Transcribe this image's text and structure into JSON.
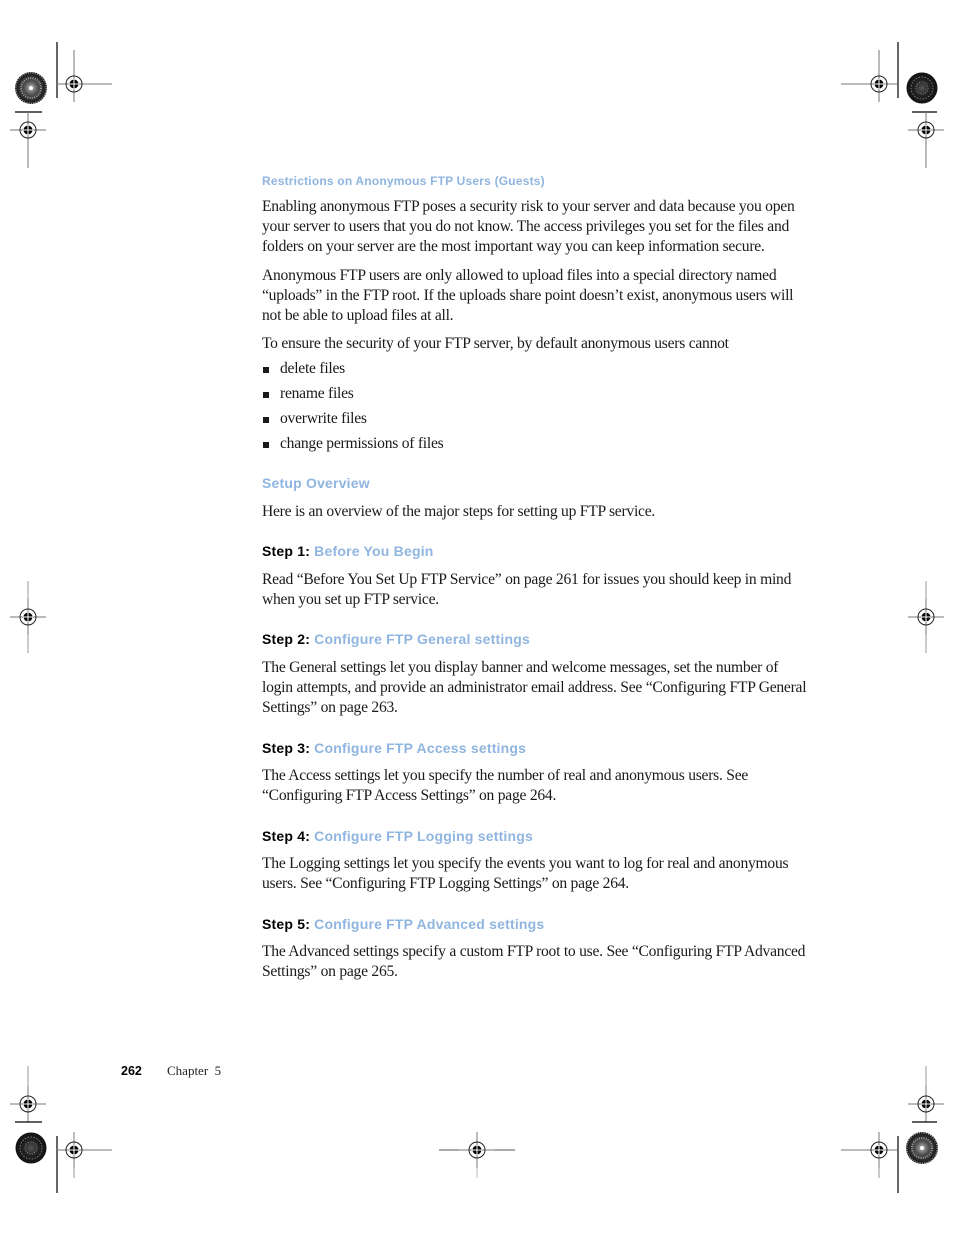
{
  "section_heading": "Restrictions on Anonymous FTP Users (Guests)",
  "paragraphs": {
    "p1": "Enabling anonymous FTP poses a security risk to your server and data because you open your server to users that you do not know. The access privileges you set for the files and folders on your server are the most important way you can keep information secure.",
    "p2": "Anonymous FTP users are only allowed to upload files into a special directory named “uploads” in the FTP root. If the uploads share point doesn’t exist, anonymous users will not be able to upload files at all.",
    "p3": "To ensure the security of your FTP server, by default anonymous users cannot"
  },
  "restrictions": [
    "delete files",
    "rename files",
    "overwrite files",
    "change permissions of files"
  ],
  "setup_overview": {
    "heading": "Setup Overview",
    "intro": "Here is an overview of the major steps for setting up FTP service."
  },
  "steps": [
    {
      "label": "Step 1:",
      "title": "Before You Begin",
      "text": "Read “Before You Set Up FTP Service” on page 261 for issues you should keep in mind when you set up FTP service."
    },
    {
      "label": "Step 2:",
      "title": "Configure FTP General settings",
      "text": "The General settings let you display banner and welcome messages, set the number of login attempts, and provide an administrator email address. See “Configuring FTP General Settings” on page 263."
    },
    {
      "label": "Step 3:",
      "title": "Configure FTP Access settings",
      "text": "The Access settings let you specify the number of real and anonymous users. See “Configuring FTP Access Settings” on page 264."
    },
    {
      "label": "Step 4:",
      "title": "Configure FTP Logging settings",
      "text": "The Logging settings let you specify the events you want to log for real and anonymous users. See “Configuring FTP Logging Settings” on page 264."
    },
    {
      "label": "Step 5:",
      "title": "Configure FTP Advanced settings",
      "text": "The Advanced settings specify a custom FTP root to use. See “Configuring FTP Advanced Settings” on page 265."
    }
  ],
  "footer": {
    "page_number": "262",
    "chapter": "Chapter  5"
  },
  "colors": {
    "heading_blue": "#8fb5e0",
    "body_text": "#1a1a1a"
  }
}
